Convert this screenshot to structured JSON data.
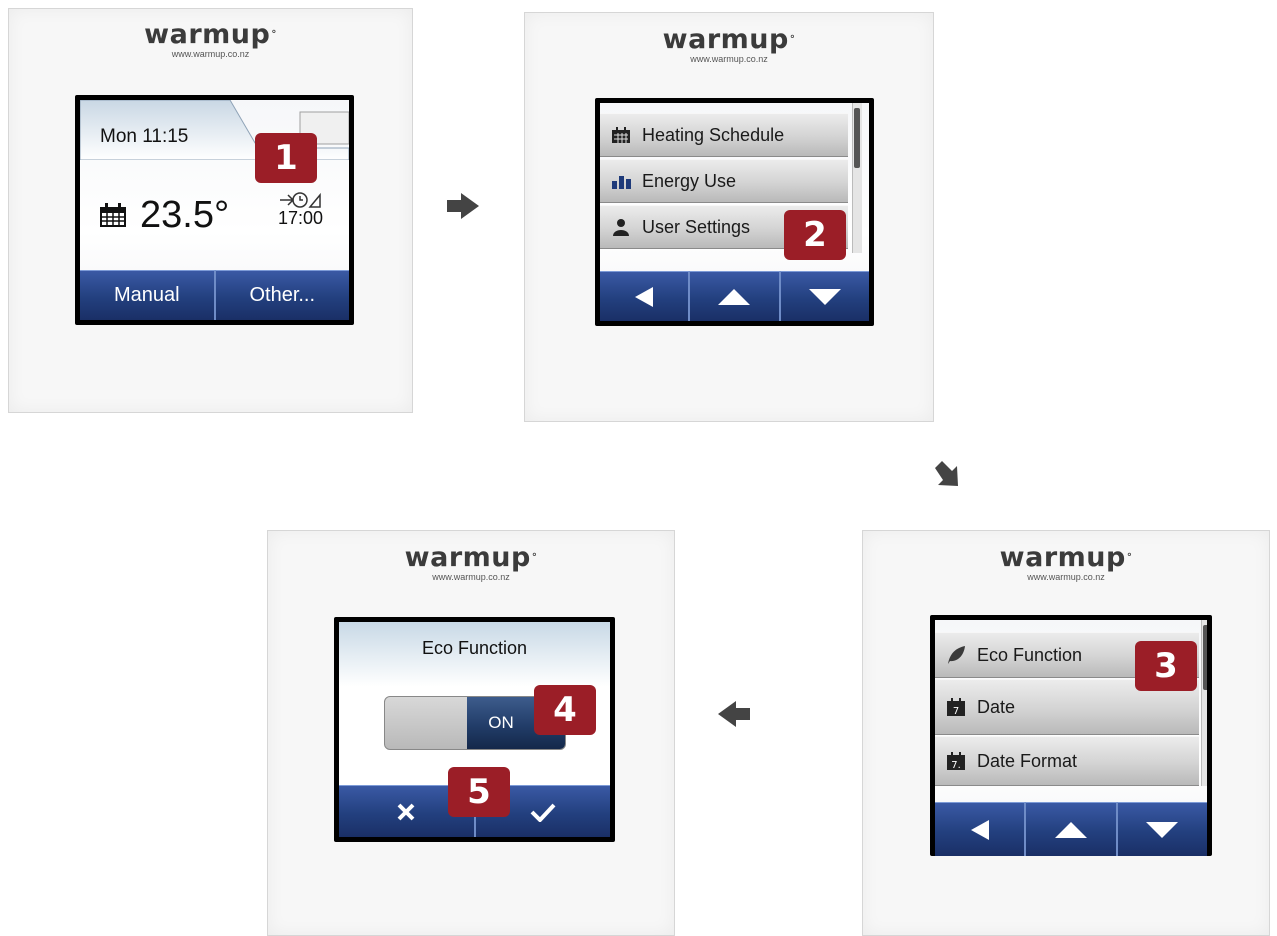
{
  "logo": {
    "brand": "warmup",
    "url": "www.warmup.co.nz"
  },
  "panel1": {
    "day_time": "Mon 11:15",
    "temperature": "23.5°",
    "schedule_time": "17:00",
    "buttons": [
      "Manual",
      "Other..."
    ],
    "badge": "1"
  },
  "panel2": {
    "menu": [
      "Heating Schedule",
      "Energy Use",
      "User Settings"
    ],
    "badge": "2"
  },
  "panel3": {
    "menu": [
      "Eco Function",
      "Date",
      "Date Format"
    ],
    "badge": "3"
  },
  "panel4": {
    "title": "Eco Function",
    "toggle_label": "ON",
    "badge_toggle": "4",
    "badge_confirm": "5"
  },
  "colors": {
    "badge": "#9b1e27",
    "nav_blue": "#23407f"
  }
}
